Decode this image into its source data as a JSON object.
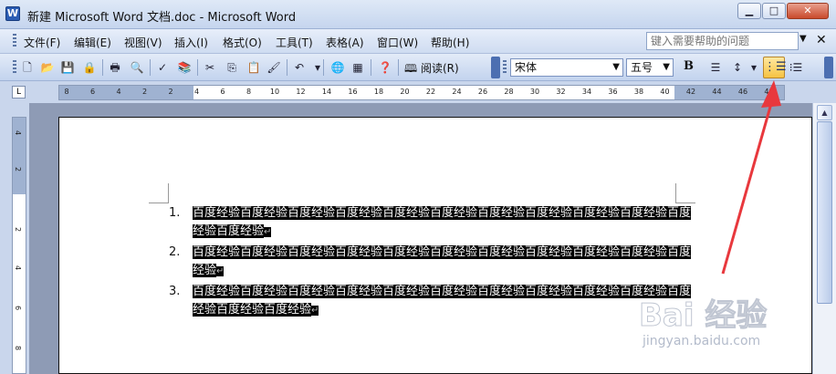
{
  "window": {
    "title": "新建 Microsoft Word 文档.doc - Microsoft Word",
    "minimize": "▁",
    "maximize": "□",
    "close": "✕"
  },
  "menu": {
    "items": [
      "文件(F)",
      "编辑(E)",
      "视图(V)",
      "插入(I)",
      "格式(O)",
      "工具(T)",
      "表格(A)",
      "窗口(W)",
      "帮助(H)"
    ],
    "help_placeholder": "键入需要帮助的问题",
    "help_arrow": "▼",
    "doc_close": "✕"
  },
  "toolbar": {
    "read_label": "阅读(R)",
    "font_name": "宋体",
    "font_size": "五号",
    "bold_label": "B",
    "numbering_glyph": "⋮☰",
    "bullets_glyph": "⁝☰"
  },
  "ruler": {
    "corner": "L",
    "numbers": [
      "8",
      "6",
      "4",
      "2",
      "2",
      "4",
      "6",
      "8",
      "10",
      "12",
      "14",
      "16",
      "18",
      "20",
      "22",
      "24",
      "26",
      "28",
      "30",
      "32",
      "34",
      "36",
      "38",
      "40",
      "42",
      "44",
      "46",
      "48"
    ],
    "vertical_numbers": [
      "4",
      "2",
      "2",
      "4",
      "6",
      "8"
    ]
  },
  "document": {
    "list": [
      {
        "number": "1.",
        "text": "百度经验百度经验百度经验百度经验百度经验百度经验百度经验百度经验百度经验百度经验百度经验百度经验"
      },
      {
        "number": "2.",
        "text": "百度经验百度经验百度经验百度经验百度经验百度经验百度经验百度经验百度经验百度经验百度经验"
      },
      {
        "number": "3.",
        "text": "百度经验百度经验百度经验百度经验百度经验百度经验百度经验百度经验百度经验百度经验百度经验百度经验百度经验"
      }
    ],
    "paragraph_mark": "↵"
  },
  "watermark": {
    "logo": "Bai 经验",
    "url": "jingyan.baidu.com"
  },
  "colors": {
    "annotation_arrow": "#e8383d",
    "selection": "#000000",
    "accent": "#f5c242"
  }
}
